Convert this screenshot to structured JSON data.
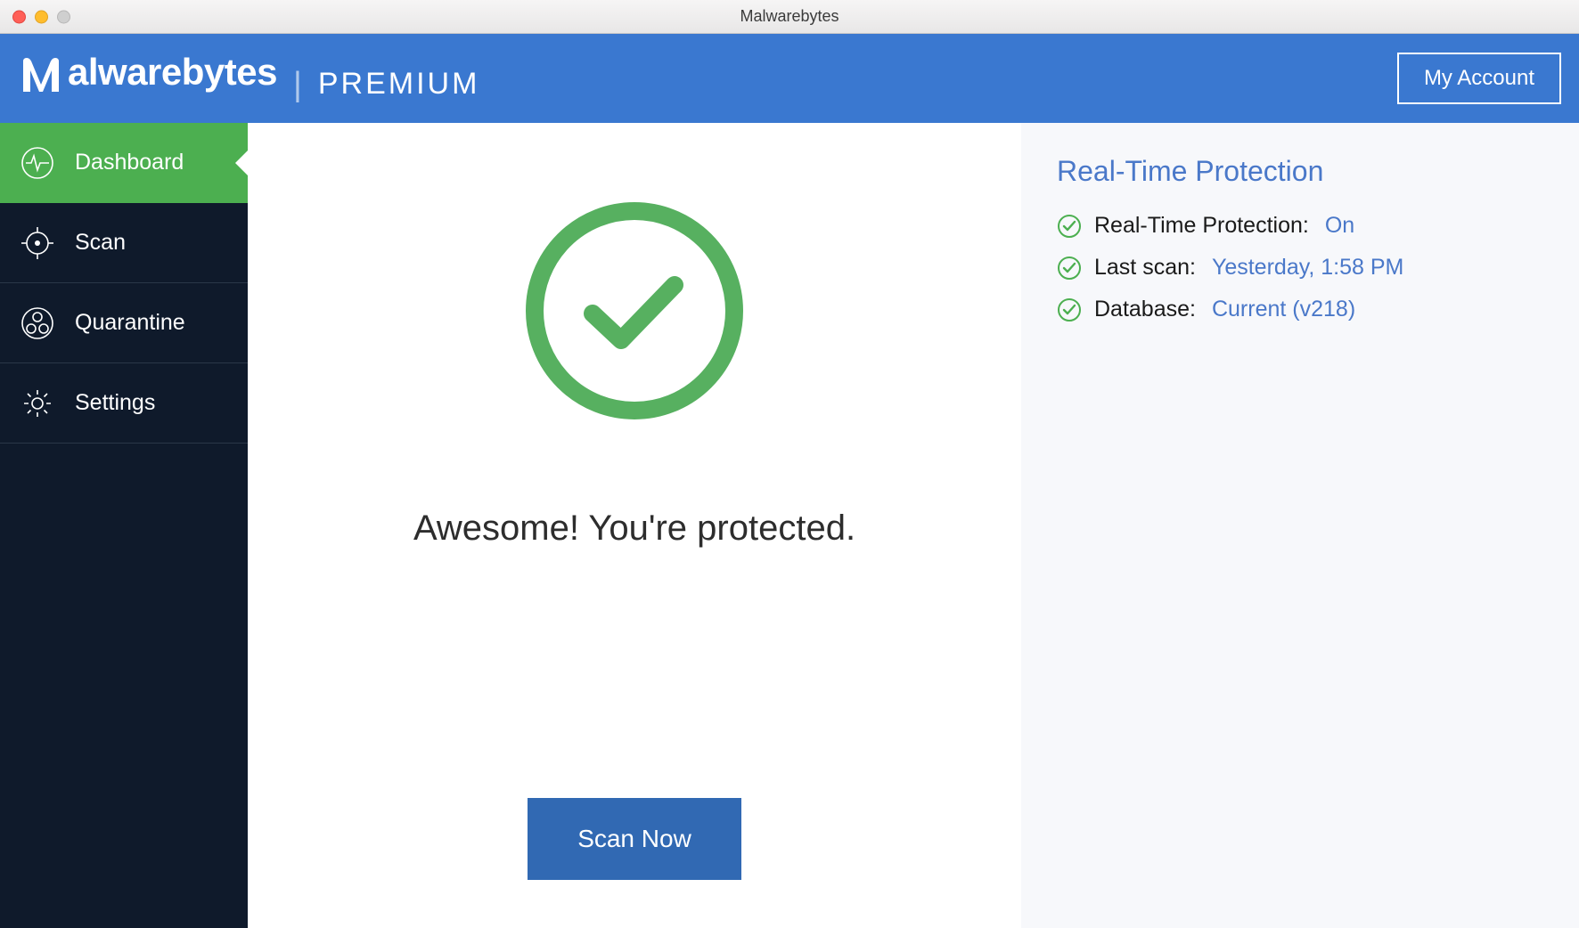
{
  "window": {
    "title": "Malwarebytes"
  },
  "header": {
    "brand": "alwarebytes",
    "tier": "PREMIUM",
    "account_label": "My Account"
  },
  "sidebar": {
    "items": [
      {
        "id": "dashboard",
        "label": "Dashboard",
        "icon": "pulse-icon",
        "active": true
      },
      {
        "id": "scan",
        "label": "Scan",
        "icon": "target-icon",
        "active": false
      },
      {
        "id": "quarantine",
        "label": "Quarantine",
        "icon": "biohazard-icon",
        "active": false
      },
      {
        "id": "settings",
        "label": "Settings",
        "icon": "gear-icon",
        "active": false
      }
    ]
  },
  "main": {
    "status_message": "Awesome! You're protected.",
    "status_icon": "check-circle-icon",
    "scan_button": "Scan Now"
  },
  "realtime": {
    "title": "Real-Time Protection",
    "rows": [
      {
        "label": "Real-Time Protection:",
        "value": "On"
      },
      {
        "label": "Last scan:",
        "value": "Yesterday, 1:58 PM"
      },
      {
        "label": "Database:",
        "value": "Current (v218)"
      }
    ]
  },
  "colors": {
    "accent_blue": "#3a78d0",
    "link_blue": "#4a78c9",
    "sidebar_dark": "#0f1a2b",
    "ok_green": "#4caf50"
  }
}
